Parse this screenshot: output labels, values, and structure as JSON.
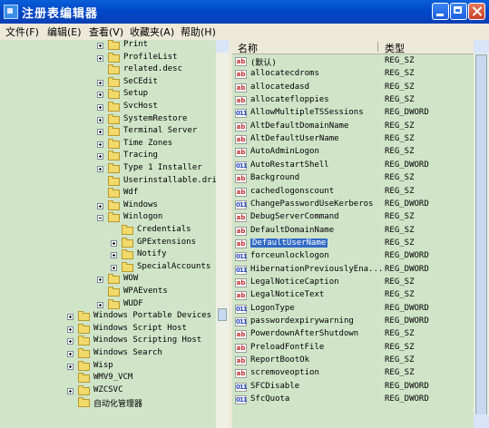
{
  "window": {
    "title": "注册表编辑器"
  },
  "menu": [
    "文件(F)",
    "编辑(E)",
    "查看(V)",
    "收藏夹(A)",
    "帮助(H)"
  ],
  "tree": [
    {
      "label": "Print",
      "expander": "plus",
      "indent": 1
    },
    {
      "label": "ProfileList",
      "expander": "plus",
      "indent": 1
    },
    {
      "label": "related.desc",
      "expander": "none",
      "indent": 1
    },
    {
      "label": "SeCEdit",
      "expander": "plus",
      "indent": 1
    },
    {
      "label": "Setup",
      "expander": "plus",
      "indent": 1
    },
    {
      "label": "SvcHost",
      "expander": "plus",
      "indent": 1
    },
    {
      "label": "SystemRestore",
      "expander": "plus",
      "indent": 1
    },
    {
      "label": "Terminal Server",
      "expander": "plus",
      "indent": 1
    },
    {
      "label": "Time Zones",
      "expander": "plus",
      "indent": 1
    },
    {
      "label": "Tracing",
      "expander": "plus",
      "indent": 1
    },
    {
      "label": "Type 1 Installer",
      "expander": "plus",
      "indent": 1
    },
    {
      "label": "Userinstallable.driv",
      "expander": "none",
      "indent": 1
    },
    {
      "label": "Wdf",
      "expander": "none",
      "indent": 1
    },
    {
      "label": "Windows",
      "expander": "plus",
      "indent": 1
    },
    {
      "label": "Winlogon",
      "expander": "minus",
      "indent": 1
    },
    {
      "label": "Credentials",
      "expander": "none",
      "indent": 2
    },
    {
      "label": "GPExtensions",
      "expander": "plus",
      "indent": 2
    },
    {
      "label": "Notify",
      "expander": "plus",
      "indent": 2
    },
    {
      "label": "SpecialAccounts",
      "expander": "plus",
      "indent": 2
    },
    {
      "label": "WOW",
      "expander": "plus",
      "indent": 1
    },
    {
      "label": "WPAEvents",
      "expander": "none",
      "indent": 1
    },
    {
      "label": "WUDF",
      "expander": "plus",
      "indent": 1
    },
    {
      "label": "Windows Portable Devices",
      "expander": "plus",
      "indent": 0
    },
    {
      "label": "Windows Script Host",
      "expander": "plus",
      "indent": 0
    },
    {
      "label": "Windows Scripting Host",
      "expander": "plus",
      "indent": 0
    },
    {
      "label": "Windows Search",
      "expander": "plus",
      "indent": 0
    },
    {
      "label": "Wisp",
      "expander": "plus",
      "indent": 0
    },
    {
      "label": "WMV9_VCM",
      "expander": "none",
      "indent": 0
    },
    {
      "label": "WZCSVC",
      "expander": "plus",
      "indent": 0
    },
    {
      "label": "自动化管理器",
      "expander": "none",
      "indent": 0
    }
  ],
  "values": {
    "header": {
      "name": "名称",
      "type": "类型"
    },
    "rows": [
      {
        "name": "(默认)",
        "type": "REG_SZ",
        "kind": "sz"
      },
      {
        "name": "allocatecdroms",
        "type": "REG_SZ",
        "kind": "sz"
      },
      {
        "name": "allocatedasd",
        "type": "REG_SZ",
        "kind": "sz"
      },
      {
        "name": "allocatefloppies",
        "type": "REG_SZ",
        "kind": "sz"
      },
      {
        "name": "AllowMultipleTSSessions",
        "type": "REG_DWORD",
        "kind": "dw"
      },
      {
        "name": "AltDefaultDomainName",
        "type": "REG_SZ",
        "kind": "sz"
      },
      {
        "name": "AltDefaultUserName",
        "type": "REG_SZ",
        "kind": "sz"
      },
      {
        "name": "AutoAdminLogon",
        "type": "REG_SZ",
        "kind": "sz"
      },
      {
        "name": "AutoRestartShell",
        "type": "REG_DWORD",
        "kind": "dw"
      },
      {
        "name": "Background",
        "type": "REG_SZ",
        "kind": "sz"
      },
      {
        "name": "cachedlogonscount",
        "type": "REG_SZ",
        "kind": "sz"
      },
      {
        "name": "ChangePasswordUseKerberos",
        "type": "REG_DWORD",
        "kind": "dw"
      },
      {
        "name": "DebugServerCommand",
        "type": "REG_SZ",
        "kind": "sz"
      },
      {
        "name": "DefaultDomainName",
        "type": "REG_SZ",
        "kind": "sz"
      },
      {
        "name": "DefaultUserName",
        "type": "REG_SZ",
        "kind": "sz",
        "selected": true
      },
      {
        "name": "forceunlocklogon",
        "type": "REG_DWORD",
        "kind": "dw"
      },
      {
        "name": "HibernationPreviouslyEna...",
        "type": "REG_DWORD",
        "kind": "dw"
      },
      {
        "name": "LegalNoticeCaption",
        "type": "REG_SZ",
        "kind": "sz"
      },
      {
        "name": "LegalNoticeText",
        "type": "REG_SZ",
        "kind": "sz"
      },
      {
        "name": "LogonType",
        "type": "REG_DWORD",
        "kind": "dw"
      },
      {
        "name": "passwordexpirywarning",
        "type": "REG_DWORD",
        "kind": "dw"
      },
      {
        "name": "PowerdownAfterShutdown",
        "type": "REG_SZ",
        "kind": "sz"
      },
      {
        "name": "PreloadFontFile",
        "type": "REG_SZ",
        "kind": "sz"
      },
      {
        "name": "ReportBootOk",
        "type": "REG_SZ",
        "kind": "sz"
      },
      {
        "name": "scremoveoption",
        "type": "REG_SZ",
        "kind": "sz"
      },
      {
        "name": "SFCDisable",
        "type": "REG_DWORD",
        "kind": "dw"
      },
      {
        "name": "SfcQuota",
        "type": "REG_DWORD",
        "kind": "dw"
      }
    ]
  }
}
